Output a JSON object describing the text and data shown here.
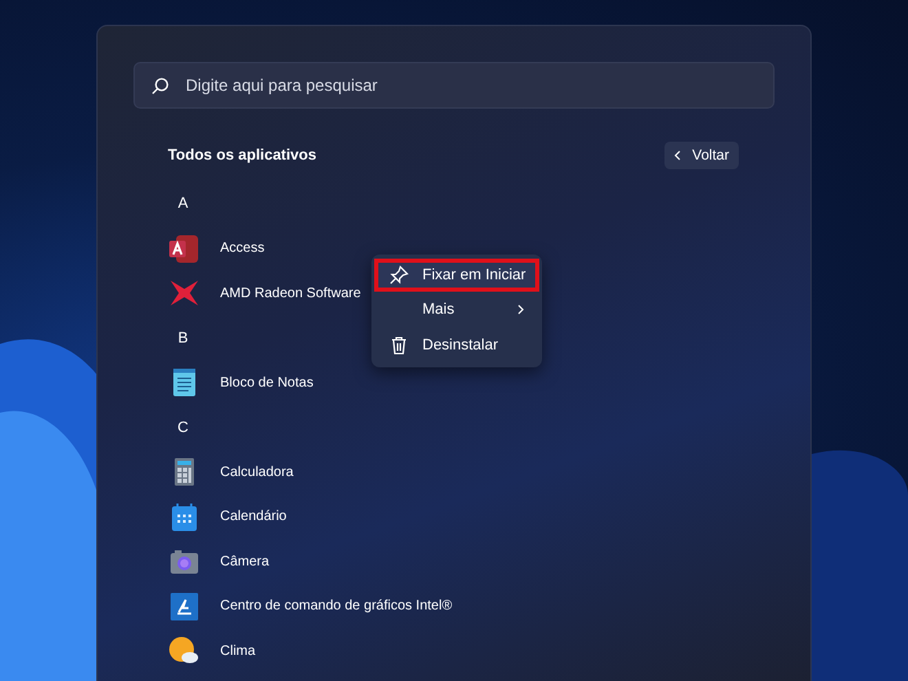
{
  "search": {
    "placeholder": "Digite aqui para pesquisar"
  },
  "header": {
    "title": "Todos os aplicativos",
    "back_button": "Voltar"
  },
  "groups": [
    {
      "letter": "A",
      "apps": [
        {
          "name": "Access"
        },
        {
          "name": "AMD Radeon Software"
        }
      ]
    },
    {
      "letter": "B",
      "apps": [
        {
          "name": "Bloco de Notas"
        }
      ]
    },
    {
      "letter": "C",
      "apps": [
        {
          "name": "Calculadora"
        },
        {
          "name": "Calendário"
        },
        {
          "name": "Câmera"
        },
        {
          "name": "Centro de comando de gráficos Intel®"
        },
        {
          "name": "Clima"
        }
      ]
    }
  ],
  "context_menu": {
    "items": [
      {
        "kind": "pin",
        "label": "Fixar em Iniciar",
        "highlighted": true
      },
      {
        "kind": "submenu",
        "label": "Mais",
        "highlighted": false
      },
      {
        "kind": "trash",
        "label": "Desinstalar",
        "highlighted": false
      }
    ]
  }
}
